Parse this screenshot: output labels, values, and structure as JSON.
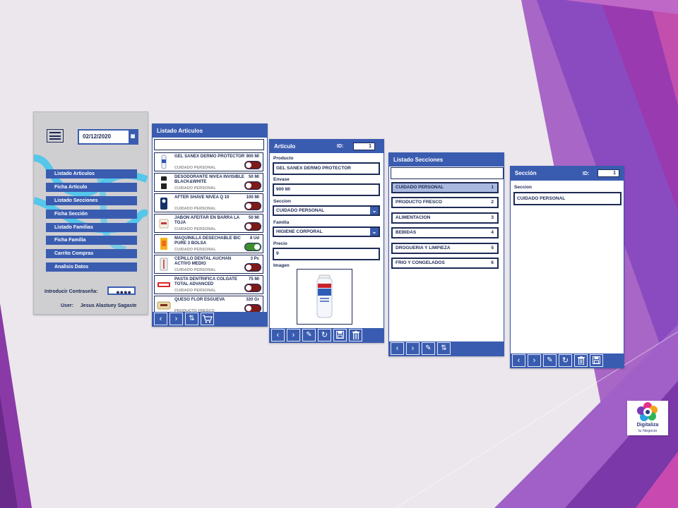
{
  "main_menu": {
    "date": "02/12/2020",
    "items": [
      "Listado Articulos",
      "Ficha Articulo",
      "Listado Secciones",
      "Ficha Sección",
      "Listado Familias",
      "Ficha Familia",
      "Carrito Compras",
      "Analisis Datos"
    ],
    "password_label": "Introducir Contraseña:",
    "password_value": "●●●●",
    "user_label": "User:",
    "user_name": "Jesus Alastuey Sagaste"
  },
  "articles_list": {
    "title": "Listado Articulos",
    "items": [
      {
        "name": "GEL SANEX DERMO PROTECTOR",
        "category": "CUIDADO PERSONAL",
        "quantity": "900 Ml",
        "active": false
      },
      {
        "name": "DESODORANTE NIVEA INVISIBLE BLACK&WHITE",
        "category": "CUIDADO PERSONAL",
        "quantity": "50 Ml",
        "active": false
      },
      {
        "name": "AFTER SHAVE NIVEA Q 10",
        "category": "CUIDADO PERSONAL",
        "quantity": "100 Ml",
        "active": false
      },
      {
        "name": "JABON AFEITAR EN BARRA LA TOJA",
        "category": "CUIDADO PERSONAL",
        "quantity": "50 Ml",
        "active": false
      },
      {
        "name": "MAQUINILLA DESECHABLE BIC PURE 3 BOLSA",
        "category": "CUIDADO PERSONAL",
        "quantity": "8 Ud",
        "active": true
      },
      {
        "name": "CEPILLO DENTAL AUCHAN ACTIVO MEDIO",
        "category": "CUIDADO PERSONAL",
        "quantity": "3 Pc",
        "active": false
      },
      {
        "name": "PASTA DENTRIFICA COLGATE TOTAL ADVANCED",
        "category": "CUIDADO PERSONAL",
        "quantity": "75 Ml",
        "active": false
      },
      {
        "name": "QUESO FLOR ESGUEVA",
        "category": "PRODUCTO FRESCO",
        "quantity": "320 Gr",
        "active": false
      }
    ]
  },
  "article_form": {
    "title": "Articulo",
    "id_label": "ID:",
    "id_value": "1",
    "producto_label": "Producto",
    "producto_value": "GEL SANEX DERMO PROTECTOR",
    "envase_label": "Envase",
    "envase_value": "900 Ml",
    "seccion_label": "Seccion",
    "seccion_value": "CUIDADO PERSONAL",
    "familia_label": "Familia",
    "familia_value": "HIGIENE CORPORAL",
    "precio_label": "Precio",
    "precio_value": "9",
    "imagen_label": "Imagen"
  },
  "sections_list": {
    "title": "Listado Secciones",
    "items": [
      {
        "name": "CUIDADO PERSONAL",
        "id": "1"
      },
      {
        "name": "PRODUCTO FRESCO",
        "id": "2"
      },
      {
        "name": "ALIMENTACION",
        "id": "3"
      },
      {
        "name": "BEBIDAS",
        "id": "4"
      },
      {
        "name": "DROGUERIA Y LIMPIEZA",
        "id": "5"
      },
      {
        "name": "FRIO Y CONGELADOS",
        "id": "6"
      }
    ]
  },
  "section_form": {
    "title": "Sección",
    "id_label": "ID:",
    "id_value": "1",
    "seccion_label": "Seccion",
    "seccion_value": "CUIDADO PERSONAL"
  },
  "logo": {
    "line1": "Digitaliza",
    "line2": "tu Negocio"
  },
  "icons": {
    "prev": "chevron-left-icon",
    "next": "chevron-right-icon",
    "sort": "sort-icon",
    "cart": "cart-icon",
    "edit": "pencil-icon",
    "refresh": "refresh-icon",
    "save": "save-icon",
    "delete": "trash-icon"
  },
  "colors": {
    "primary": "#3a5cb0",
    "text": "#1d2a55",
    "toggle_off": "#7d1a1a",
    "toggle_on": "#3d8d30",
    "selected_row": "#a9b9e0"
  }
}
